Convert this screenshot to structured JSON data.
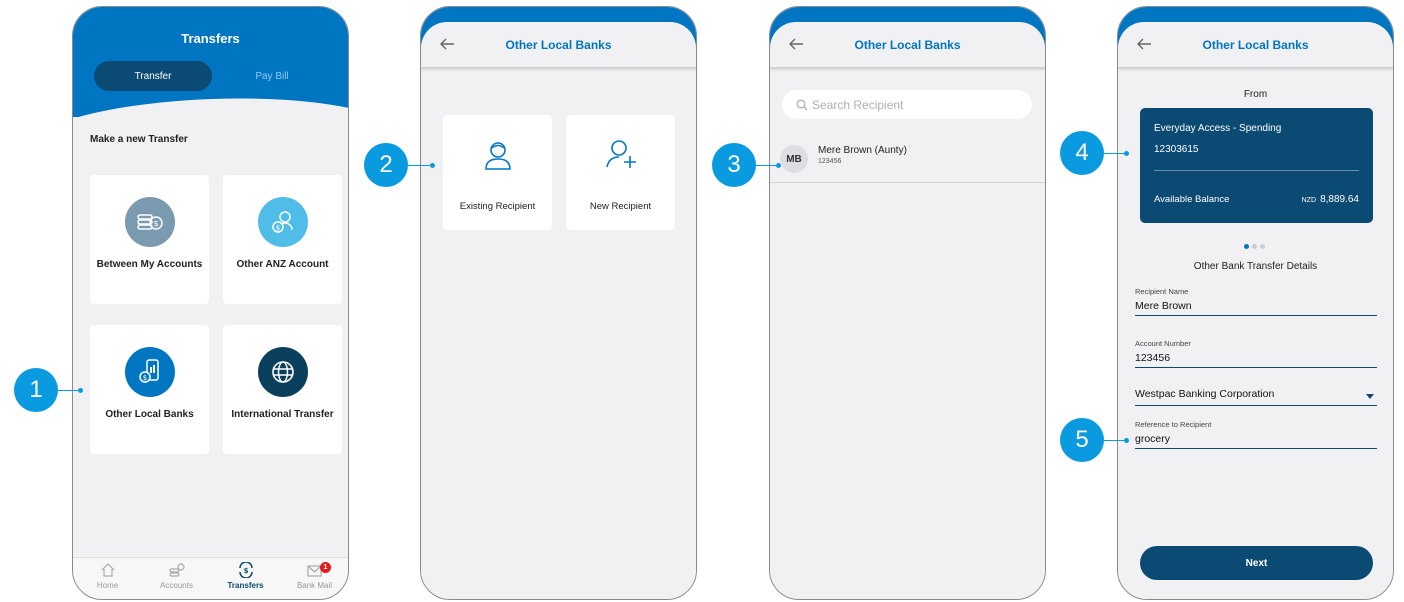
{
  "screen1": {
    "title": "Transfers",
    "segment_active": "Transfer",
    "segment_other": "Pay Bill",
    "section_heading": "Make a new Transfer",
    "tiles": [
      {
        "label": "Between My Accounts",
        "icon": "coins-icon",
        "color": "#7a9ab0"
      },
      {
        "label": "Other ANZ Account",
        "icon": "person-money-icon",
        "color": "#4fbde8"
      },
      {
        "label": "Other Local Banks",
        "icon": "phone-money-icon",
        "color": "#0076c3"
      },
      {
        "label": "International Transfer",
        "icon": "globe-icon",
        "color": "#0b3f5e"
      }
    ],
    "tabs": [
      {
        "label": "Home",
        "icon": "home-icon"
      },
      {
        "label": "Accounts",
        "icon": "accounts-icon"
      },
      {
        "label": "Transfers",
        "icon": "transfers-icon"
      },
      {
        "label": "Bank Mail",
        "icon": "mail-icon",
        "badge": "1"
      }
    ]
  },
  "screen2": {
    "title": "Other Local Banks",
    "options": [
      {
        "label": "Existing Recipient",
        "icon": "person-icon"
      },
      {
        "label": "New Recipient",
        "icon": "add-person-icon"
      }
    ]
  },
  "screen3": {
    "title": "Other Local Banks",
    "search_placeholder": "Search Recipient",
    "recipients": [
      {
        "initials": "MB",
        "name": "Mere Brown (Aunty)",
        "account": "123456"
      }
    ]
  },
  "screen4": {
    "title": "Other Local Banks",
    "from_label": "From",
    "account_name": "Everyday Access - Spending",
    "account_number": "12303615",
    "available_label": "Available Balance",
    "currency": "NZD",
    "balance": "8,889.64",
    "details_title": "Other Bank Transfer Details",
    "recipient_name_label": "Recipient Name",
    "recipient_name": "Mere Brown",
    "account_number_label": "Account Number",
    "account_number_value": "123456",
    "bank": "Westpac Banking Corporation",
    "reference_label": "Reference to Recipient",
    "reference": "grocery",
    "next_label": "Next"
  },
  "callouts": [
    "1",
    "2",
    "3",
    "4",
    "5"
  ],
  "colors": {
    "primary": "#0076c3",
    "navy": "#0b4a72",
    "callout": "#0a9ae0"
  }
}
